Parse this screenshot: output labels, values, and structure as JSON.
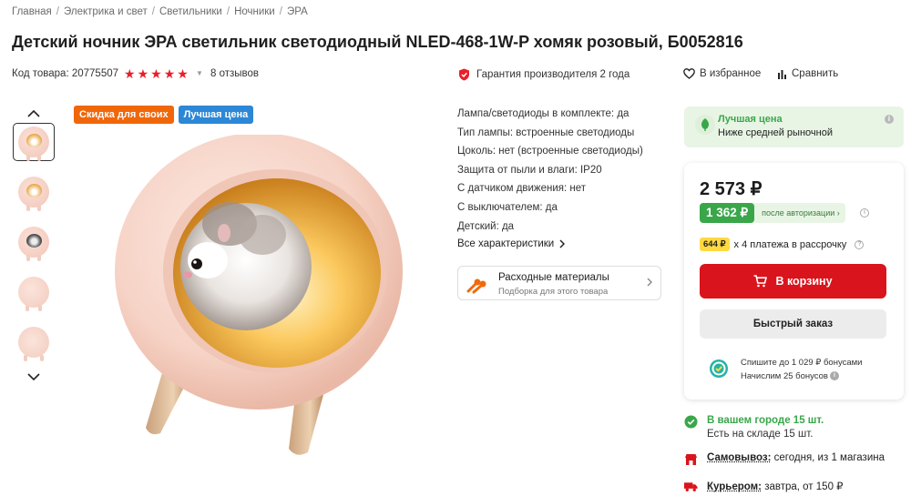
{
  "breadcrumb": {
    "items": [
      "Главная",
      "Электрика и свет",
      "Светильники",
      "Ночники",
      "ЭРА"
    ]
  },
  "product": {
    "title": "Детский ночник ЭРА светильник светодиодный NLED-468-1W-P хомяк розовый, Б0052816",
    "sku": "Код товара: 20775507",
    "rating": 5,
    "reviews": "8 отзывов",
    "warranty": "Гарантия производителя 2 года",
    "favorite": "В избранное",
    "compare": "Сравнить"
  },
  "badges": {
    "discount": "Скидка для своих",
    "best_price": "Лучшая цена"
  },
  "gallery": {
    "thumbnail_count": 5,
    "active_index": 0
  },
  "specs": {
    "items": [
      "Лампа/светодиоды в комплекте: да",
      "Тип лампы: встроенные светодиоды",
      "Цоколь: нет (встроенные светодиоды)",
      "Защита от пыли и влаги: IP20",
      "С датчиком движения: нет",
      "С выключателем: да",
      "Детский: да"
    ],
    "all_link": "Все характеристики"
  },
  "consumables": {
    "title": "Расходные материалы",
    "subtitle": "Подборка для этого товара"
  },
  "best_price_card": {
    "title": "Лучшая цена",
    "subtitle": "Ниже средней рыночной"
  },
  "buy": {
    "price": "2 573 ₽",
    "auth_price": "1 362 ₽",
    "auth_note": "после авторизации",
    "installment_chip": "644 ₽",
    "installment_text": "х 4 платежа в рассрочку",
    "cart_label": "В корзину",
    "quick_order": "Быстрый заказ",
    "bonus_line1": "Спишите до 1 029 ₽ бонусами",
    "bonus_line2": "Начислим 25 бонусов"
  },
  "availability": {
    "city": "В вашем городе 15 шт.",
    "warehouse": "Есть на складе 15 шт.",
    "pickup_label": "Самовывоз:",
    "pickup_text": " сегодня, из 1 магазина",
    "courier_label": "Курьером:",
    "courier_text": " завтра, от 150 ₽"
  },
  "colors": {
    "accent_red": "#d9141c",
    "green": "#3aa64a",
    "orange_badge": "#f0670a",
    "blue_badge": "#2c87d6"
  }
}
